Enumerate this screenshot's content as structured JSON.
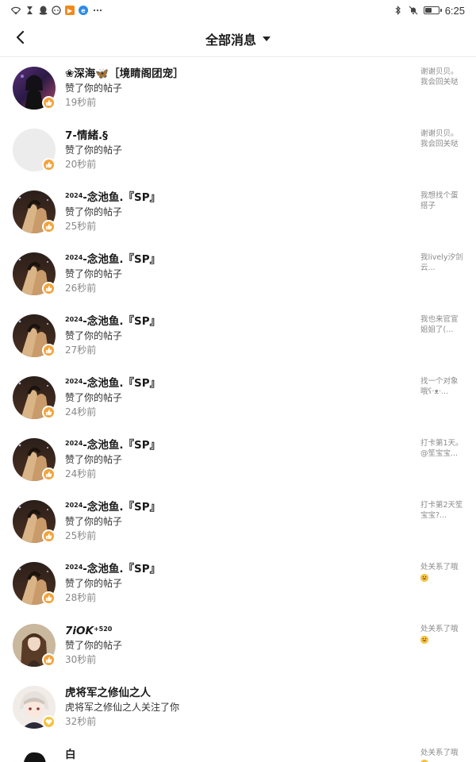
{
  "status_bar": {
    "time": "6:25",
    "left_icons": [
      "wifi-icon",
      "hourglass-icon",
      "qq-icon",
      "chat-icon",
      "app-orange-icon",
      "app-blue-icon",
      "more-dots-icon"
    ],
    "right_icons": [
      "bluetooth-icon",
      "mute-bell-icon",
      "battery-icon"
    ],
    "battery_level": 0.5
  },
  "header": {
    "title": "全部消息"
  },
  "messages": [
    {
      "name": "❀深海🦋［境睛阁团宠］",
      "action": "赞了你的帖子",
      "time": "19秒前",
      "preview": "谢谢贝贝。我会回关哒",
      "avatar": "dark-girl",
      "badge": "like"
    },
    {
      "name": "7-情緒.§",
      "action": "赞了你的帖子",
      "time": "20秒前",
      "preview": "谢谢贝贝。我会回关哒",
      "avatar": "blank",
      "badge": "like"
    },
    {
      "name": "念池鱼.『SP』",
      "name_prefix": "2024",
      "action": "赞了你的帖子",
      "time": "25秒前",
      "preview": "我想找个蛋搭子",
      "avatar": "couple",
      "badge": "like"
    },
    {
      "name": "念池鱼.『SP』",
      "name_prefix": "2024",
      "action": "赞了你的帖子",
      "time": "26秒前",
      "preview": "我lively汐剑云...",
      "avatar": "couple",
      "badge": "like"
    },
    {
      "name": "念池鱼.『SP』",
      "name_prefix": "2024",
      "action": "赞了你的帖子",
      "time": "27秒前",
      "preview": "我也来官宣姐姐了(...",
      "avatar": "couple",
      "badge": "like"
    },
    {
      "name": "念池鱼.『SP』",
      "name_prefix": "2024",
      "action": "赞了你的帖子",
      "time": "24秒前",
      "preview": "找一个对象哦ʕ·ᴥ·...",
      "avatar": "couple",
      "badge": "like"
    },
    {
      "name": "念池鱼.『SP』",
      "name_prefix": "2024",
      "action": "赞了你的帖子",
      "time": "24秒前",
      "preview": "打卡第1天。@笙宝宝...",
      "avatar": "couple",
      "badge": "like"
    },
    {
      "name": "念池鱼.『SP』",
      "name_prefix": "2024",
      "action": "赞了你的帖子",
      "time": "25秒前",
      "preview": "打卡第2天笙宝宝?...",
      "avatar": "couple",
      "badge": "like"
    },
    {
      "name": "念池鱼.『SP』",
      "name_prefix": "2024",
      "action": "赞了你的帖子",
      "time": "28秒前",
      "preview": "处关系了哦",
      "preview_emoji": true,
      "avatar": "couple",
      "badge": "like"
    },
    {
      "name": "7iOK",
      "name_suffix": "+520",
      "action": "赞了你的帖子",
      "time": "30秒前",
      "preview": "处关系了哦",
      "preview_emoji": true,
      "avatar": "brown-hair",
      "badge": "like"
    },
    {
      "name": "虎将军之修仙之人",
      "action": "虎将军之修仙之人关注了你",
      "time": "32秒前",
      "preview": "",
      "avatar": "anime",
      "badge": "follow"
    },
    {
      "name": "白",
      "action": "",
      "time": "",
      "preview": "处关系了哦",
      "preview_emoji": true,
      "avatar": "dark-hair",
      "badge": "none"
    }
  ]
}
